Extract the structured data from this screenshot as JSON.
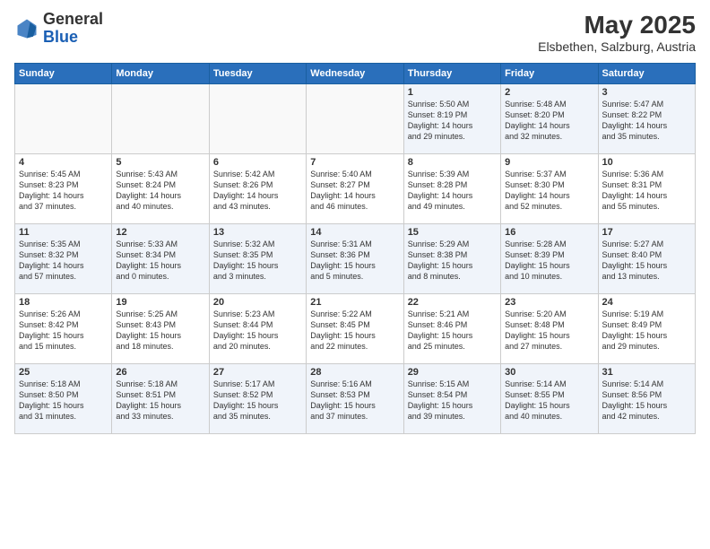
{
  "header": {
    "logo_general": "General",
    "logo_blue": "Blue",
    "month_year": "May 2025",
    "location": "Elsbethen, Salzburg, Austria"
  },
  "days_of_week": [
    "Sunday",
    "Monday",
    "Tuesday",
    "Wednesday",
    "Thursday",
    "Friday",
    "Saturday"
  ],
  "weeks": [
    [
      {
        "num": "",
        "info": ""
      },
      {
        "num": "",
        "info": ""
      },
      {
        "num": "",
        "info": ""
      },
      {
        "num": "",
        "info": ""
      },
      {
        "num": "1",
        "info": "Sunrise: 5:50 AM\nSunset: 8:19 PM\nDaylight: 14 hours\nand 29 minutes."
      },
      {
        "num": "2",
        "info": "Sunrise: 5:48 AM\nSunset: 8:20 PM\nDaylight: 14 hours\nand 32 minutes."
      },
      {
        "num": "3",
        "info": "Sunrise: 5:47 AM\nSunset: 8:22 PM\nDaylight: 14 hours\nand 35 minutes."
      }
    ],
    [
      {
        "num": "4",
        "info": "Sunrise: 5:45 AM\nSunset: 8:23 PM\nDaylight: 14 hours\nand 37 minutes."
      },
      {
        "num": "5",
        "info": "Sunrise: 5:43 AM\nSunset: 8:24 PM\nDaylight: 14 hours\nand 40 minutes."
      },
      {
        "num": "6",
        "info": "Sunrise: 5:42 AM\nSunset: 8:26 PM\nDaylight: 14 hours\nand 43 minutes."
      },
      {
        "num": "7",
        "info": "Sunrise: 5:40 AM\nSunset: 8:27 PM\nDaylight: 14 hours\nand 46 minutes."
      },
      {
        "num": "8",
        "info": "Sunrise: 5:39 AM\nSunset: 8:28 PM\nDaylight: 14 hours\nand 49 minutes."
      },
      {
        "num": "9",
        "info": "Sunrise: 5:37 AM\nSunset: 8:30 PM\nDaylight: 14 hours\nand 52 minutes."
      },
      {
        "num": "10",
        "info": "Sunrise: 5:36 AM\nSunset: 8:31 PM\nDaylight: 14 hours\nand 55 minutes."
      }
    ],
    [
      {
        "num": "11",
        "info": "Sunrise: 5:35 AM\nSunset: 8:32 PM\nDaylight: 14 hours\nand 57 minutes."
      },
      {
        "num": "12",
        "info": "Sunrise: 5:33 AM\nSunset: 8:34 PM\nDaylight: 15 hours\nand 0 minutes."
      },
      {
        "num": "13",
        "info": "Sunrise: 5:32 AM\nSunset: 8:35 PM\nDaylight: 15 hours\nand 3 minutes."
      },
      {
        "num": "14",
        "info": "Sunrise: 5:31 AM\nSunset: 8:36 PM\nDaylight: 15 hours\nand 5 minutes."
      },
      {
        "num": "15",
        "info": "Sunrise: 5:29 AM\nSunset: 8:38 PM\nDaylight: 15 hours\nand 8 minutes."
      },
      {
        "num": "16",
        "info": "Sunrise: 5:28 AM\nSunset: 8:39 PM\nDaylight: 15 hours\nand 10 minutes."
      },
      {
        "num": "17",
        "info": "Sunrise: 5:27 AM\nSunset: 8:40 PM\nDaylight: 15 hours\nand 13 minutes."
      }
    ],
    [
      {
        "num": "18",
        "info": "Sunrise: 5:26 AM\nSunset: 8:42 PM\nDaylight: 15 hours\nand 15 minutes."
      },
      {
        "num": "19",
        "info": "Sunrise: 5:25 AM\nSunset: 8:43 PM\nDaylight: 15 hours\nand 18 minutes."
      },
      {
        "num": "20",
        "info": "Sunrise: 5:23 AM\nSunset: 8:44 PM\nDaylight: 15 hours\nand 20 minutes."
      },
      {
        "num": "21",
        "info": "Sunrise: 5:22 AM\nSunset: 8:45 PM\nDaylight: 15 hours\nand 22 minutes."
      },
      {
        "num": "22",
        "info": "Sunrise: 5:21 AM\nSunset: 8:46 PM\nDaylight: 15 hours\nand 25 minutes."
      },
      {
        "num": "23",
        "info": "Sunrise: 5:20 AM\nSunset: 8:48 PM\nDaylight: 15 hours\nand 27 minutes."
      },
      {
        "num": "24",
        "info": "Sunrise: 5:19 AM\nSunset: 8:49 PM\nDaylight: 15 hours\nand 29 minutes."
      }
    ],
    [
      {
        "num": "25",
        "info": "Sunrise: 5:18 AM\nSunset: 8:50 PM\nDaylight: 15 hours\nand 31 minutes."
      },
      {
        "num": "26",
        "info": "Sunrise: 5:18 AM\nSunset: 8:51 PM\nDaylight: 15 hours\nand 33 minutes."
      },
      {
        "num": "27",
        "info": "Sunrise: 5:17 AM\nSunset: 8:52 PM\nDaylight: 15 hours\nand 35 minutes."
      },
      {
        "num": "28",
        "info": "Sunrise: 5:16 AM\nSunset: 8:53 PM\nDaylight: 15 hours\nand 37 minutes."
      },
      {
        "num": "29",
        "info": "Sunrise: 5:15 AM\nSunset: 8:54 PM\nDaylight: 15 hours\nand 39 minutes."
      },
      {
        "num": "30",
        "info": "Sunrise: 5:14 AM\nSunset: 8:55 PM\nDaylight: 15 hours\nand 40 minutes."
      },
      {
        "num": "31",
        "info": "Sunrise: 5:14 AM\nSunset: 8:56 PM\nDaylight: 15 hours\nand 42 minutes."
      }
    ]
  ]
}
